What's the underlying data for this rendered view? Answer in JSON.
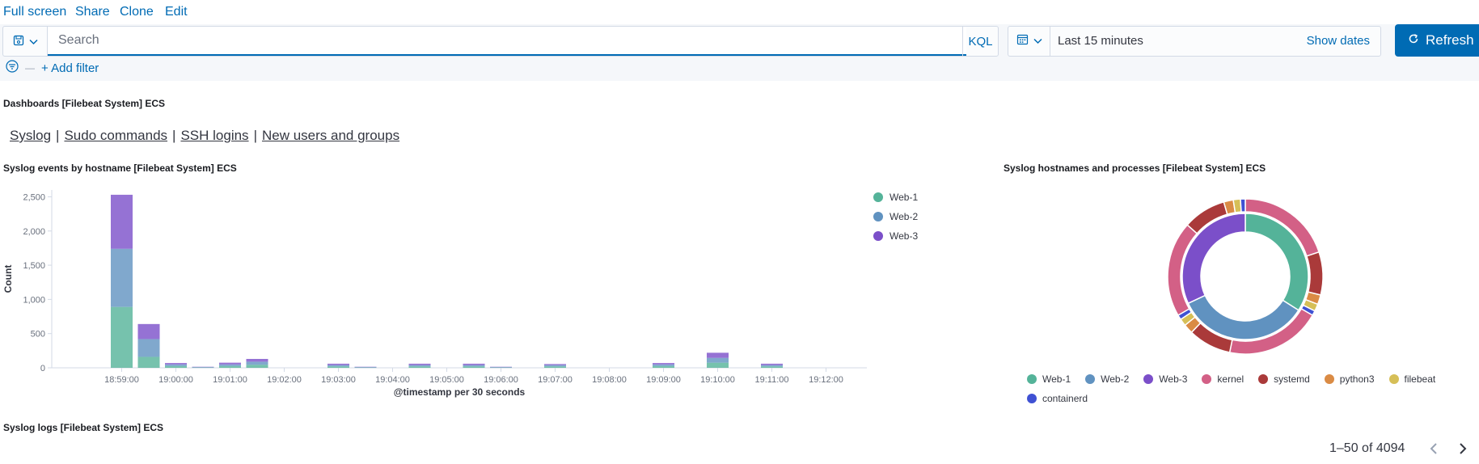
{
  "topnav": {
    "full_screen": "Full screen",
    "share": "Share",
    "clone": "Clone",
    "edit": "Edit"
  },
  "query": {
    "search_placeholder": "Search",
    "search_value": "",
    "language": "KQL"
  },
  "date_picker": {
    "range": "Last 15 minutes",
    "show_dates": "Show dates"
  },
  "refresh": {
    "label": "Refresh"
  },
  "filters": {
    "add_filter": "+ Add filter"
  },
  "panels": {
    "dashboards": {
      "title": "Dashboards [Filebeat System] ECS",
      "links": [
        "Syslog",
        "Sudo commands",
        "SSH logins",
        "New users and groups"
      ],
      "separator": "|"
    },
    "syslog_events": {
      "title": "Syslog events by hostname [Filebeat System] ECS"
    },
    "hostnames_processes": {
      "title": "Syslog hostnames and processes [Filebeat System] ECS"
    },
    "syslog_logs": {
      "title": "Syslog logs [Filebeat System] ECS"
    }
  },
  "chart_data": [
    {
      "type": "bar",
      "stacked": true,
      "xlabel": "@timestamp per 30 seconds",
      "ylabel": "Count",
      "ylim": [
        0,
        2600
      ],
      "yticks": [
        0,
        500,
        1000,
        1500,
        2000,
        2500
      ],
      "ytick_labels": [
        "0",
        "500",
        "1,000",
        "1,500",
        "2,000",
        "2,500"
      ],
      "xtick_labels": [
        "18:59:00",
        "19:00:00",
        "19:01:00",
        "19:02:00",
        "19:03:00",
        "19:04:00",
        "19:05:00",
        "19:06:00",
        "19:07:00",
        "19:08:00",
        "19:09:00",
        "19:10:00",
        "19:11:00",
        "19:12:00"
      ],
      "categories": [
        "18:59:00",
        "18:59:30",
        "19:00:00",
        "19:00:30",
        "19:01:00",
        "19:01:30",
        "19:02:00",
        "19:02:30",
        "19:03:00",
        "19:03:30",
        "19:04:00",
        "19:04:30",
        "19:05:00",
        "19:05:30",
        "19:06:00",
        "19:06:30",
        "19:07:00",
        "19:07:30",
        "19:08:00",
        "19:08:30",
        "19:09:00",
        "19:09:30",
        "19:10:00",
        "19:10:30",
        "19:11:00",
        "19:11:30",
        "19:12:00",
        "19:12:30"
      ],
      "series": [
        {
          "name": "Web-1",
          "color": "#54b399",
          "values": [
            890,
            160,
            25,
            5,
            25,
            45,
            0,
            0,
            20,
            5,
            0,
            20,
            0,
            20,
            5,
            0,
            20,
            0,
            0,
            0,
            25,
            0,
            75,
            0,
            20,
            0,
            0,
            0
          ]
        },
        {
          "name": "Web-2",
          "color": "#6092c0",
          "values": [
            850,
            260,
            25,
            5,
            25,
            45,
            0,
            0,
            20,
            5,
            0,
            20,
            0,
            20,
            5,
            0,
            20,
            0,
            0,
            0,
            25,
            0,
            70,
            0,
            20,
            0,
            0,
            0
          ]
        },
        {
          "name": "Web-3",
          "color": "#7b4fc9",
          "values": [
            790,
            220,
            20,
            5,
            25,
            40,
            0,
            0,
            20,
            5,
            0,
            20,
            0,
            20,
            5,
            0,
            15,
            0,
            0,
            0,
            20,
            0,
            75,
            0,
            20,
            0,
            0,
            0
          ]
        }
      ],
      "legend_position": "right",
      "grid": false
    },
    {
      "type": "pie",
      "donut": true,
      "rings": [
        {
          "level": "hostname",
          "slices": [
            {
              "label": "Web-1",
              "value": 34,
              "color": "#54b399"
            },
            {
              "label": "Web-2",
              "value": 34,
              "color": "#6092c0"
            },
            {
              "label": "Web-3",
              "value": 32,
              "color": "#7b4fc9"
            }
          ]
        },
        {
          "level": "process",
          "slices": [
            {
              "label": "kernel",
              "value": 20,
              "color": "#d36086"
            },
            {
              "label": "systemd",
              "value": 9,
              "color": "#aa3a3a"
            },
            {
              "label": "python3",
              "value": 2,
              "color": "#da8b45"
            },
            {
              "label": "filebeat",
              "value": 1.5,
              "color": "#d6bf57"
            },
            {
              "label": "containerd",
              "value": 1,
              "color": "#3f51d3"
            },
            {
              "label": "kernel",
              "value": 20,
              "color": "#d36086"
            },
            {
              "label": "systemd",
              "value": 9,
              "color": "#aa3a3a"
            },
            {
              "label": "python3",
              "value": 2,
              "color": "#da8b45"
            },
            {
              "label": "filebeat",
              "value": 1.5,
              "color": "#d6bf57"
            },
            {
              "label": "containerd",
              "value": 1,
              "color": "#3f51d3"
            },
            {
              "label": "kernel",
              "value": 20,
              "color": "#d36086"
            },
            {
              "label": "systemd",
              "value": 9,
              "color": "#aa3a3a"
            },
            {
              "label": "python3",
              "value": 2,
              "color": "#da8b45"
            },
            {
              "label": "filebeat",
              "value": 1.5,
              "color": "#d6bf57"
            },
            {
              "label": "containerd",
              "value": 1,
              "color": "#3f51d3"
            }
          ]
        }
      ],
      "legend": [
        {
          "label": "Web-1",
          "color": "#54b399"
        },
        {
          "label": "Web-2",
          "color": "#6092c0"
        },
        {
          "label": "Web-3",
          "color": "#7b4fc9"
        },
        {
          "label": "kernel",
          "color": "#d36086"
        },
        {
          "label": "systemd",
          "color": "#aa3a3a"
        },
        {
          "label": "python3",
          "color": "#da8b45"
        },
        {
          "label": "filebeat",
          "color": "#d6bf57"
        },
        {
          "label": "containerd",
          "color": "#3f51d3"
        }
      ]
    }
  ],
  "pagination": {
    "range": "1–50 of 4094"
  },
  "colors": {
    "accent": "#006bb4",
    "querybar_bg": "#f5f7fa"
  },
  "icons": {
    "saved_query": "save-icon",
    "calendar": "calendar-icon",
    "refresh": "refresh-icon",
    "filter": "filter-icon"
  }
}
